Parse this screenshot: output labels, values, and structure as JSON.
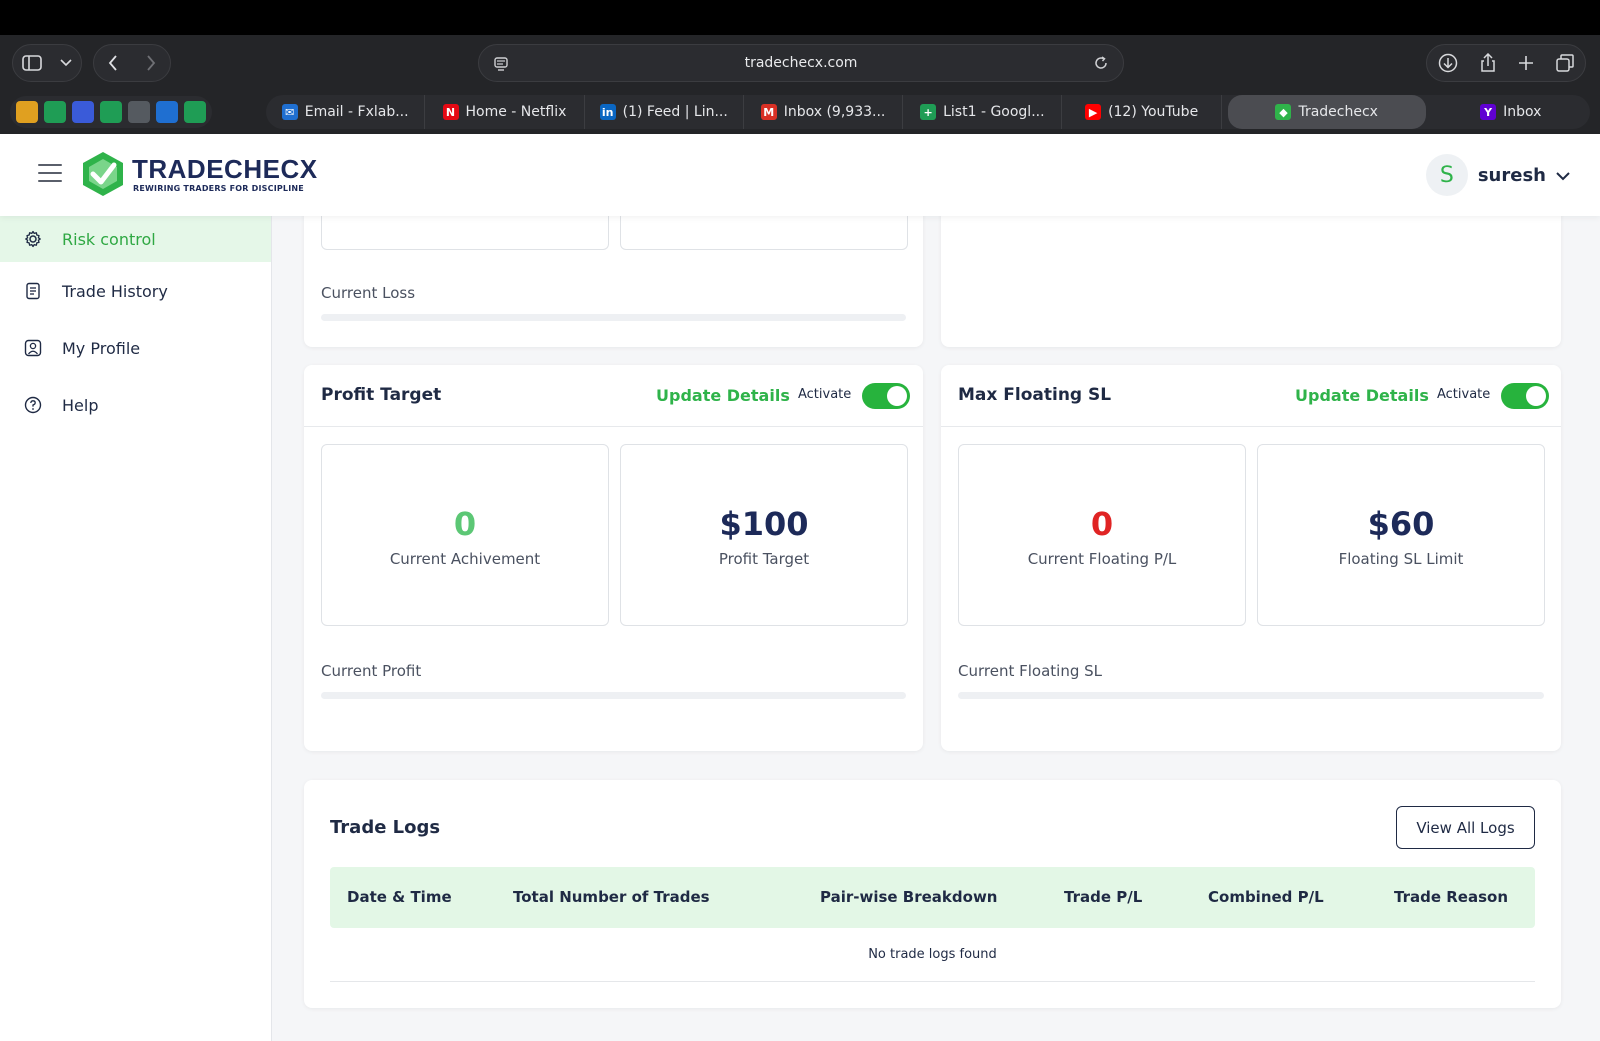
{
  "browser": {
    "url": "tradechecx.com",
    "pinned": [
      {
        "icon": "spreadsheet-yellow-icon",
        "color": "#e0a020"
      },
      {
        "icon": "sheets-plus-icon",
        "color": "#1f9d55"
      },
      {
        "icon": "framer-icon",
        "color": "#3a5bd9"
      },
      {
        "icon": "sheets-plus-icon",
        "color": "#1f9d55"
      },
      {
        "icon": "notion-icon",
        "color": "#555a60"
      },
      {
        "icon": "outlook-icon",
        "color": "#1f6fd1"
      },
      {
        "icon": "sheets-plus-icon",
        "color": "#1f9d55"
      }
    ],
    "tabs": [
      {
        "label": "Email - Fxlab...",
        "icon": "outlook-icon",
        "color": "#1f6fd1",
        "glyph": "✉"
      },
      {
        "label": "Home - Netflix",
        "icon": "netflix-icon",
        "color": "#e50914",
        "glyph": "N"
      },
      {
        "label": "(1) Feed | Lin...",
        "icon": "linkedin-icon",
        "color": "#0a66c2",
        "glyph": "in"
      },
      {
        "label": "Inbox (9,933...",
        "icon": "gmail-icon",
        "color": "#d93025",
        "glyph": "M"
      },
      {
        "label": "List1 - Googl...",
        "icon": "sheets-icon",
        "color": "#1f9d55",
        "glyph": "+"
      },
      {
        "label": "(12) YouTube",
        "icon": "youtube-icon",
        "color": "#ff0000",
        "glyph": "▶"
      },
      {
        "label": "Tradechecx",
        "icon": "tradechecx-icon",
        "color": "#2fb34a",
        "glyph": "◆",
        "active": true
      },
      {
        "label": "Inbox",
        "icon": "yahoo-icon",
        "color": "#6001d2",
        "glyph": "Y"
      }
    ]
  },
  "header": {
    "brand": "TRADECHECX",
    "tagline": "REWIRING TRADERS FOR DISCIPLINE",
    "user_initial": "S",
    "user_name": "suresh"
  },
  "sidebar": {
    "items": [
      {
        "label": "Risk control",
        "icon": "gear-icon",
        "active": true
      },
      {
        "label": "Trade History",
        "icon": "document-icon"
      },
      {
        "label": "My Profile",
        "icon": "profile-icon"
      },
      {
        "label": "Help",
        "icon": "help-icon"
      }
    ]
  },
  "top_card": {
    "progress_label": "Current Loss"
  },
  "profit_target": {
    "title": "Profit Target",
    "update_label": "Update Details",
    "activate_label": "Activate",
    "active": true,
    "achievement_value": "0",
    "achievement_label": "Current Achivement",
    "target_value": "$100",
    "target_label": "Profit Target",
    "progress_label": "Current Profit",
    "progress": 0
  },
  "max_floating_sl": {
    "title": "Max Floating SL",
    "update_label": "Update Details",
    "activate_label": "Activate",
    "active": true,
    "floating_value": "0",
    "floating_label": "Current Floating P/L",
    "limit_value": "$60",
    "limit_label": "Floating SL Limit",
    "progress_label": "Current Floating SL",
    "progress": 0
  },
  "trade_logs": {
    "title": "Trade Logs",
    "view_all_label": "View All Logs",
    "columns": [
      "Date & Time",
      "Total Number of Trades",
      "Pair-wise Breakdown",
      "Trade P/L",
      "Combined P/L",
      "Trade Reason"
    ],
    "empty_text": "No trade logs found"
  },
  "colors": {
    "accent_green": "#2fb34a",
    "loss_red": "#e02424",
    "navy": "#1d2a59",
    "achievement_green": "#5cc775"
  }
}
